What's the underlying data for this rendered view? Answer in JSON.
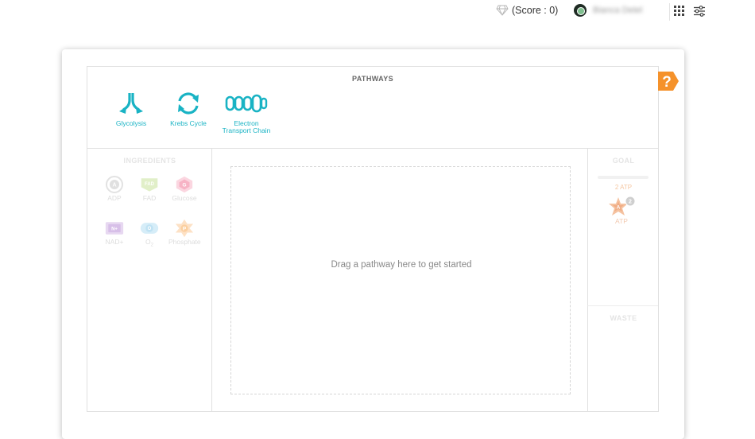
{
  "topbar": {
    "score_label": "(Score : 0)",
    "username": "Bianca Detel"
  },
  "pathways": {
    "title": "PATHWAYS",
    "items": [
      {
        "label_line1": "Glycolysis",
        "label_line2": "",
        "icon": "glycolysis-icon"
      },
      {
        "label_line1": "Krebs Cycle",
        "label_line2": "",
        "icon": "krebs-cycle-icon"
      },
      {
        "label_line1": "Electron",
        "label_line2": "Transport Chain",
        "icon": "electron-transport-chain-icon"
      }
    ]
  },
  "ingredients": {
    "title": "INGREDIENTS",
    "items": [
      {
        "symbol": "A",
        "label": "ADP",
        "color": "#d9d9d9"
      },
      {
        "symbol": "FAD",
        "label": "FAD",
        "color": "#cfe6a8"
      },
      {
        "symbol": "G",
        "label": "Glucose",
        "color": "#f6b8c8"
      },
      {
        "symbol": "N+",
        "label": "NAD+",
        "color": "#dcc7ea"
      },
      {
        "symbol": "O",
        "label": "O",
        "sub": "2",
        "color": "#bfe2f3"
      },
      {
        "symbol": "P",
        "label": "Phosphate",
        "color": "#fbd3ae"
      }
    ]
  },
  "workspace": {
    "placeholder": "Drag a pathway here to get started"
  },
  "goal": {
    "title": "GOAL",
    "requirement": "2 ATP",
    "item_label": "ATP",
    "item_symbol": "A",
    "item_count": "2"
  },
  "waste": {
    "title": "WASTE"
  },
  "help": {
    "symbol": "?",
    "color": "#f5922b"
  },
  "colors": {
    "accent": "#19b3c4"
  }
}
